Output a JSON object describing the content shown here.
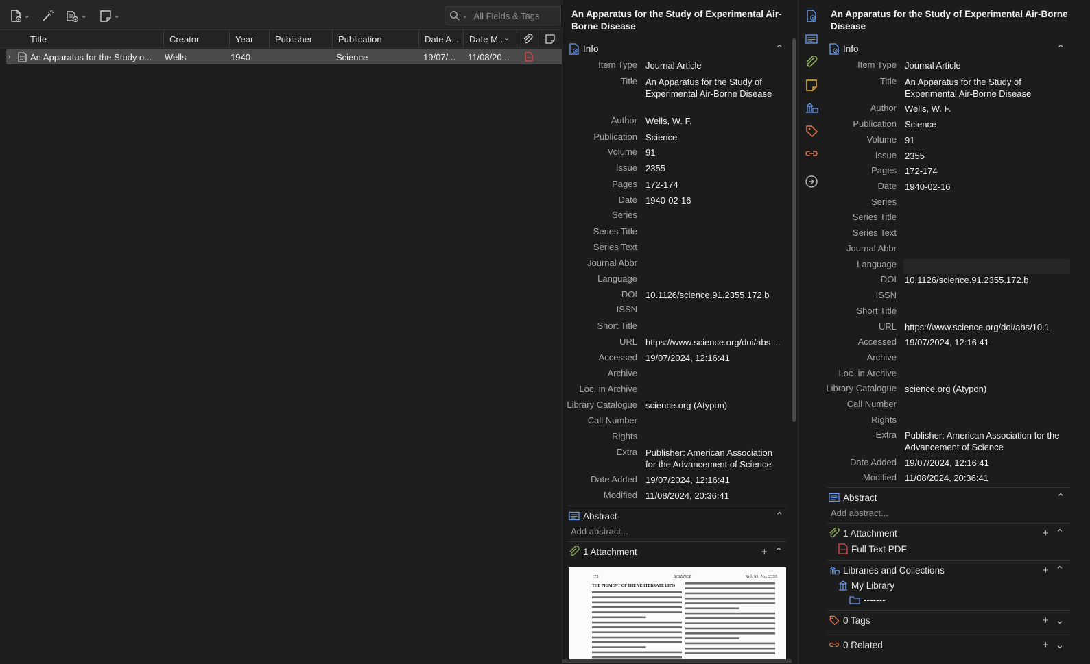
{
  "toolbar": {
    "new_item_icon": "new-item-icon",
    "wand_icon": "magic-wand-icon",
    "add_attachment_icon": "add-attachment-icon",
    "new_note_icon": "new-note-icon",
    "search_placeholder": "All Fields & Tags"
  },
  "columns": {
    "title": "Title",
    "creator": "Creator",
    "year": "Year",
    "publisher": "Publisher",
    "publication": "Publication",
    "date_added": "Date A...",
    "date_modified": "Date M..."
  },
  "items": [
    {
      "title": "An Apparatus for the Study o...",
      "creator": "Wells",
      "year": "1940",
      "publisher": "",
      "publication": "Science",
      "date_added": "19/07/...",
      "date_modified": "11/08/20..."
    }
  ],
  "item_pane": {
    "title": "An Apparatus for the Study of Experimental Air-Borne Disease",
    "info_heading": "Info",
    "fields": [
      {
        "label": "Item Type",
        "value": "Journal Article"
      },
      {
        "label": "Title",
        "value": "An Apparatus for the Study of Experimental Air-Borne Disease"
      },
      {
        "label": "Author",
        "value": "Wells, W. F."
      },
      {
        "label": "Publication",
        "value": "Science"
      },
      {
        "label": "Volume",
        "value": "91"
      },
      {
        "label": "Issue",
        "value": "2355"
      },
      {
        "label": "Pages",
        "value": "172-174"
      },
      {
        "label": "Date",
        "value": "1940-02-16"
      },
      {
        "label": "Series",
        "value": ""
      },
      {
        "label": "Series Title",
        "value": ""
      },
      {
        "label": "Series Text",
        "value": ""
      },
      {
        "label": "Journal Abbr",
        "value": ""
      },
      {
        "label": "Language",
        "value": ""
      },
      {
        "label": "DOI",
        "value": "10.1126/science.91.2355.172.b"
      },
      {
        "label": "ISSN",
        "value": ""
      },
      {
        "label": "Short Title",
        "value": ""
      },
      {
        "label": "URL",
        "value": "https://www.science.org/doi/abs ..."
      },
      {
        "label": "Accessed",
        "value": "19/07/2024, 12:16:41"
      },
      {
        "label": "Archive",
        "value": ""
      },
      {
        "label": "Loc. in Archive",
        "value": ""
      },
      {
        "label": "Library Catalogue",
        "value": "science.org (Atypon)"
      },
      {
        "label": "Call Number",
        "value": ""
      },
      {
        "label": "Rights",
        "value": ""
      },
      {
        "label": "Extra",
        "value": "Publisher: American Association for the Advancement of Science"
      },
      {
        "label": "Date Added",
        "value": "19/07/2024, 12:16:41"
      },
      {
        "label": "Modified",
        "value": "11/08/2024, 20:36:41"
      }
    ],
    "abstract_heading": "Abstract",
    "abstract_placeholder": "Add abstract...",
    "attachments_heading": "1 Attachment",
    "pdf_preview": {
      "page": "172",
      "journal": "SCIENCE",
      "volume": "Vol. 91, No. 2355",
      "heading": "THE PIGMENT OF THE VERTEBRATE LENS"
    }
  },
  "context_pane": {
    "title": "An Apparatus for the Study of Experimental Air-Borne Disease",
    "info_heading": "Info",
    "fields": [
      {
        "label": "Item Type",
        "value": "Journal Article"
      },
      {
        "label": "Title",
        "value": "An Apparatus for the Study of Experimental Air-Borne Disease"
      },
      {
        "label": "Author",
        "value": "Wells, W. F."
      },
      {
        "label": "Publication",
        "value": "Science"
      },
      {
        "label": "Volume",
        "value": "91"
      },
      {
        "label": "Issue",
        "value": "2355"
      },
      {
        "label": "Pages",
        "value": "172-174"
      },
      {
        "label": "Date",
        "value": "1940-02-16"
      },
      {
        "label": "Series",
        "value": ""
      },
      {
        "label": "Series Title",
        "value": ""
      },
      {
        "label": "Series Text",
        "value": ""
      },
      {
        "label": "Journal Abbr",
        "value": ""
      },
      {
        "label": "Language",
        "value": ""
      },
      {
        "label": "DOI",
        "value": "10.1126/science.91.2355.172.b"
      },
      {
        "label": "ISSN",
        "value": ""
      },
      {
        "label": "Short Title",
        "value": ""
      },
      {
        "label": "URL",
        "value": "https://www.science.org/doi/abs/10.1"
      },
      {
        "label": "Accessed",
        "value": "19/07/2024, 12:16:41"
      },
      {
        "label": "Archive",
        "value": ""
      },
      {
        "label": "Loc. in Archive",
        "value": ""
      },
      {
        "label": "Library Catalogue",
        "value": "science.org (Atypon)"
      },
      {
        "label": "Call Number",
        "value": ""
      },
      {
        "label": "Rights",
        "value": ""
      },
      {
        "label": "Extra",
        "value": "Publisher: American Association for the Advancement of Science"
      },
      {
        "label": "Date Added",
        "value": "19/07/2024, 12:16:41"
      },
      {
        "label": "Modified",
        "value": "11/08/2024, 20:36:41"
      }
    ],
    "abstract_heading": "Abstract",
    "abstract_placeholder": "Add abstract...",
    "attachments_heading": "1 Attachment",
    "attachment_name": "Full Text PDF",
    "libraries_heading": "Libraries and Collections",
    "library_name": "My Library",
    "collection_name": "-------",
    "tags_heading": "0 Tags",
    "related_heading": "0 Related"
  },
  "colors": {
    "accent_blue": "#6b9cf0",
    "attachment_green": "#8fb35e",
    "notes_yellow": "#e3b341",
    "tags_orange": "#e07a4a",
    "pdf_red": "#e04a4a"
  }
}
